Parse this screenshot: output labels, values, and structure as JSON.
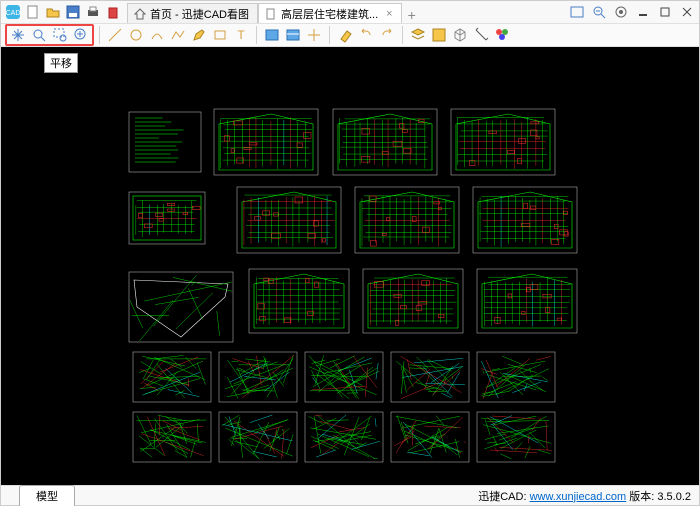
{
  "titlebar": {
    "tabs": [
      {
        "label": "首页 - 迅捷CAD看图",
        "active": false,
        "closable": false
      },
      {
        "label": "高层层住宅楼建筑...",
        "active": true,
        "closable": true
      }
    ]
  },
  "toolbar": {
    "tooltip": "平移"
  },
  "bottom": {
    "model_tab": "模型"
  },
  "status": {
    "app": "迅捷CAD:",
    "url": "www.xunjiecad.com",
    "version_label": "版本:",
    "version": "3.5.0.2"
  },
  "colors": {
    "cad_green": "#00ff00",
    "cad_red": "#ff3030",
    "cad_cyan": "#00ffff",
    "cad_yellow": "#ffff00"
  }
}
